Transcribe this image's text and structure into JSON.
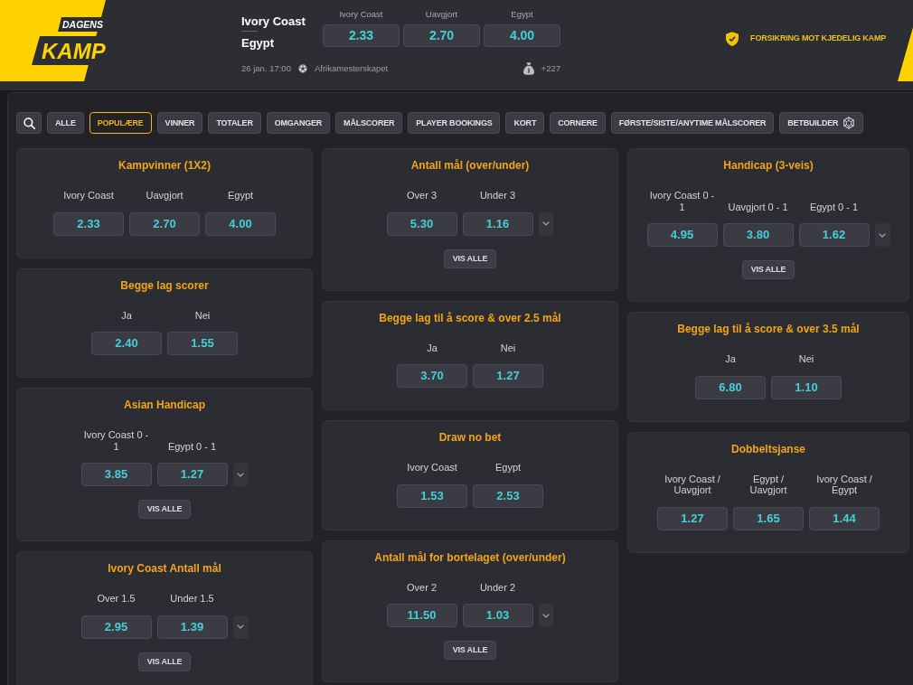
{
  "logo": {
    "top": "DAGENS",
    "bottom": "KAMP"
  },
  "match": {
    "home_team": "Ivory Coast",
    "away_team": "Egypt",
    "odds": [
      {
        "label": "Ivory Coast",
        "odds": "2.33"
      },
      {
        "label": "Uavgjort",
        "odds": "2.70"
      },
      {
        "label": "Egypt",
        "odds": "4.00"
      }
    ],
    "kickoff": "26 jan. 17:00",
    "competition": "Afrikamesterskapet",
    "extra_markets": "+227"
  },
  "insurance": "FORSIKRING MOT KJEDELIG KAMP",
  "filters": [
    {
      "label": "ALLE",
      "selected": false,
      "kind": "plain"
    },
    {
      "label": "POPULÆRE",
      "selected": true,
      "kind": "plain"
    },
    {
      "label": "VINNER",
      "selected": false,
      "kind": "plain"
    },
    {
      "label": "TOTALER",
      "selected": false,
      "kind": "plain"
    },
    {
      "label": "OMGANGER",
      "selected": false,
      "kind": "plain"
    },
    {
      "label": "MÅLSCORER",
      "selected": false,
      "kind": "plain"
    },
    {
      "label": "PLAYER BOOKINGS",
      "selected": false,
      "kind": "plain"
    },
    {
      "label": "KORT",
      "selected": false,
      "kind": "plain"
    },
    {
      "label": "CORNERE",
      "selected": false,
      "kind": "plain"
    },
    {
      "label": "FØRSTE/SISTE/ANYTIME MÅLSCORER",
      "selected": false,
      "kind": "plain"
    },
    {
      "label": "BETBUILDER",
      "selected": false,
      "kind": "icon"
    }
  ],
  "market_columns": [
    {
      "markets": [
        {
          "title": "Kampvinner (1X2)",
          "options": [
            {
              "label": "Ivory Coast",
              "odds": "2.33"
            },
            {
              "label": "Uavgjort",
              "odds": "2.70"
            },
            {
              "label": "Egypt",
              "odds": "4.00"
            }
          ],
          "dropdown": false
        },
        {
          "title": "Begge lag scorer",
          "options": [
            {
              "label": "Ja",
              "odds": "2.40"
            },
            {
              "label": "Nei",
              "odds": "1.55"
            }
          ],
          "dropdown": false
        },
        {
          "title": "Asian Handicap",
          "options": [
            {
              "label": "Ivory Coast 0 - 1",
              "odds": "3.85"
            },
            {
              "label": "Egypt 0 - 1",
              "odds": "1.27"
            }
          ],
          "dropdown": true,
          "show_all": "VIS ALLE"
        },
        {
          "title": "Ivory Coast Antall mål",
          "options": [
            {
              "label": "Over 1.5",
              "odds": "2.95"
            },
            {
              "label": "Under 1.5",
              "odds": "1.39"
            }
          ],
          "dropdown": true,
          "show_all": "VIS ALLE"
        }
      ]
    },
    {
      "markets": [
        {
          "title": "Antall mål (over/under)",
          "options": [
            {
              "label": "Over 3",
              "odds": "5.30"
            },
            {
              "label": "Under 3",
              "odds": "1.16"
            }
          ],
          "dropdown": true,
          "show_all": "VIS ALLE"
        },
        {
          "title": "Begge lag til å score & over 2.5 mål",
          "options": [
            {
              "label": "Ja",
              "odds": "3.70"
            },
            {
              "label": "Nei",
              "odds": "1.27"
            }
          ],
          "dropdown": false
        },
        {
          "title": "Draw no bet",
          "options": [
            {
              "label": "Ivory Coast",
              "odds": "1.53"
            },
            {
              "label": "Egypt",
              "odds": "2.53"
            }
          ],
          "dropdown": false
        },
        {
          "title": "Antall mål for bortelaget (over/under)",
          "options": [
            {
              "label": "Over 2",
              "odds": "11.50"
            },
            {
              "label": "Under 2",
              "odds": "1.03"
            }
          ],
          "dropdown": true,
          "show_all": "VIS ALLE"
        }
      ]
    },
    {
      "markets": [
        {
          "title": "Handicap (3-veis)",
          "options": [
            {
              "label": "Ivory Coast 0 - 1",
              "odds": "4.95"
            },
            {
              "label": "Uavgjort 0 - 1",
              "odds": "3.80"
            },
            {
              "label": "Egypt 0 - 1",
              "odds": "1.62"
            }
          ],
          "dropdown": true,
          "show_all": "VIS ALLE"
        },
        {
          "title": "Begge lag til å score & over 3.5 mål",
          "options": [
            {
              "label": "Ja",
              "odds": "6.80"
            },
            {
              "label": "Nei",
              "odds": "1.10"
            }
          ],
          "dropdown": false
        },
        {
          "title": "Dobbeltsjanse",
          "options": [
            {
              "label": "Ivory Coast / Uavgjort",
              "odds": "1.27"
            },
            {
              "label": "Egypt / Uavgjort",
              "odds": "1.65"
            },
            {
              "label": "Ivory Coast / Egypt",
              "odds": "1.44"
            }
          ],
          "dropdown": false
        }
      ]
    }
  ]
}
